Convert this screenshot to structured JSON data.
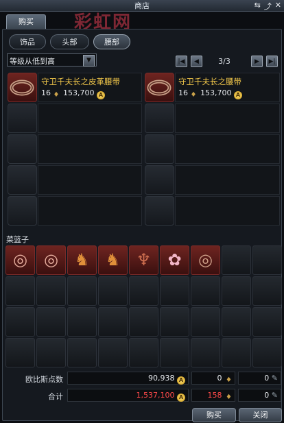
{
  "window": {
    "title": "商店"
  },
  "watermark": "彩虹网",
  "tabs": {
    "buy": "购买"
  },
  "categories": [
    "饰品",
    "头部",
    "腰部"
  ],
  "sort": {
    "label": "等级从低到高"
  },
  "pager": {
    "text": "3/3"
  },
  "items": [
    {
      "name": "守卫千夫长之皮革腰带",
      "level": "16",
      "price": "153,700"
    },
    {
      "name": "守卫千夫长之腰带",
      "level": "16",
      "price": "153,700"
    }
  ],
  "basket": {
    "label": "菜篮子",
    "icons": [
      "ring-item-icon",
      "ring-item-icon",
      "beast-helm-icon",
      "beast-helm-icon",
      "dragon-mask-icon",
      "pink-creature-icon",
      "belt-item-icon"
    ]
  },
  "summary": {
    "ohbis_label": "欧比斯点数",
    "ohbis_gold": "90,938",
    "ohbis_b": "0",
    "ohbis_c": "0",
    "total_label": "合计",
    "total_gold": "1,537,100",
    "total_b": "158",
    "total_c": "0"
  },
  "buttons": {
    "buy": "购买",
    "close": "关闭"
  },
  "colors": {
    "item_name": "#f0c64a",
    "total_red": "#ff4a4a"
  }
}
